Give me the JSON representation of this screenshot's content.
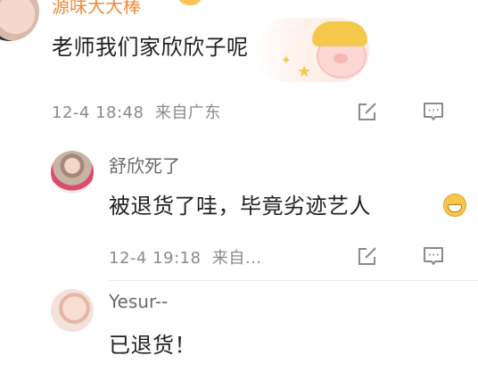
{
  "comments": [
    {
      "username": "源味大大棒",
      "text": "老师我们家欣欣子呢",
      "timestamp": "12-4 18:48",
      "location": "来自广东",
      "has_sticker": true,
      "sticker_name": "pig-with-hat"
    }
  ],
  "replies": [
    {
      "username": "舒欣死了",
      "text": "被退货了哇，毕竟劣迹艺人",
      "emoji": "grinning-face",
      "timestamp": "12-4 19:18",
      "location_truncated": "来自..."
    },
    {
      "username": "Yesur--",
      "text": "已退货！"
    }
  ],
  "icons": {
    "share": "share-icon",
    "reply": "comment-icon"
  },
  "colors": {
    "highlight_username": "#f08a3c",
    "meta_text": "#8a8a8a",
    "reply_username": "#6a6a6a"
  }
}
